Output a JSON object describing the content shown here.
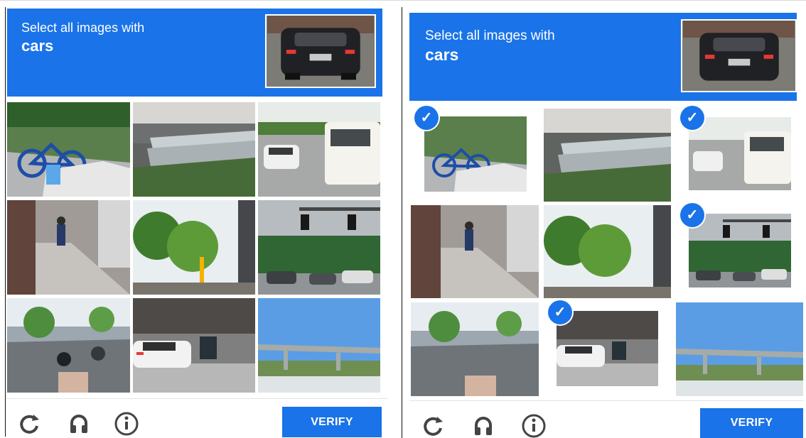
{
  "widgets": [
    {
      "id": "left",
      "prompt": "Select all images with",
      "target": "cars",
      "verify_label": "VERIFY",
      "selected_tiles": []
    },
    {
      "id": "right",
      "prompt": "Select all images with",
      "target": "cars",
      "verify_label": "VERIFY",
      "selected_tiles": [
        1,
        3,
        6,
        8
      ]
    }
  ],
  "tiles": [
    {
      "index": 1,
      "content": "bicycle next to silver car"
    },
    {
      "index": 2,
      "content": "road guardrail"
    },
    {
      "index": 3,
      "content": "white car and bus"
    },
    {
      "index": 4,
      "content": "sidewalk with pedestrian"
    },
    {
      "index": 5,
      "content": "trees and traffic light"
    },
    {
      "index": 6,
      "content": "traffic light over parked cars"
    },
    {
      "index": 7,
      "content": "scooters on street"
    },
    {
      "index": 8,
      "content": "white car and scooter"
    },
    {
      "index": 9,
      "content": "bridge under blue sky"
    }
  ],
  "colors": {
    "brand_blue": "#1a73e8",
    "icon_gray": "#444444"
  },
  "icons": [
    "reload-icon",
    "audio-icon",
    "info-icon",
    "check-icon"
  ]
}
